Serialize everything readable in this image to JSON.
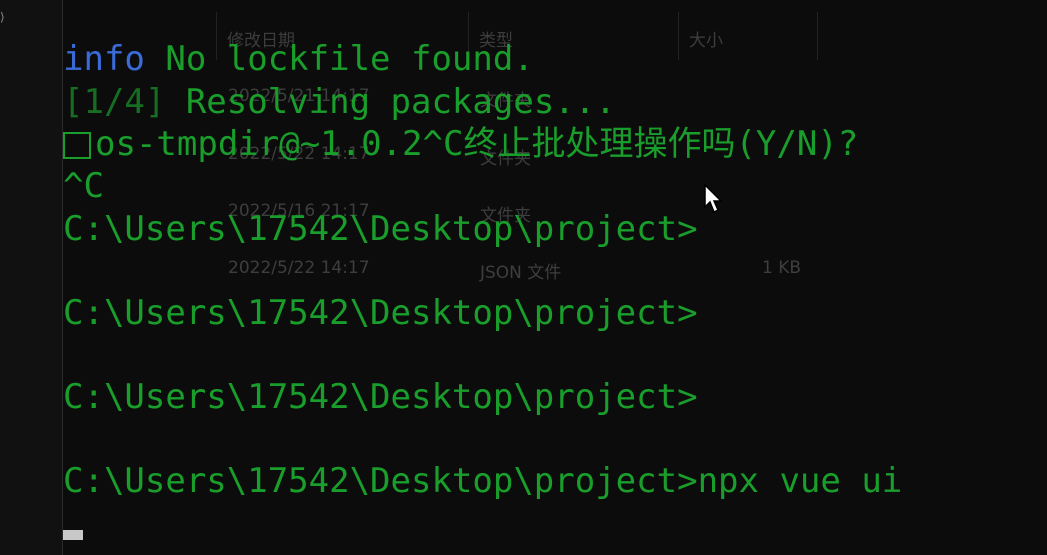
{
  "explorer_ghost": {
    "headers": [
      "修改日期",
      "类型",
      "大小"
    ],
    "rows": [
      {
        "date": "2022/5/21 14:17",
        "type": "文件夹",
        "size": ""
      },
      {
        "date": "2022/5/22 14:17",
        "type": "文件夹",
        "size": ""
      },
      {
        "date": "2022/5/16 21:17",
        "type": "文件夹",
        "size": ""
      },
      {
        "date": "2022/5/22 14:17",
        "type": "JSON 文件",
        "size": "1 KB"
      }
    ]
  },
  "terminal": {
    "info_tag": "info",
    "info_text": " No lockfile found.",
    "progress_step": "[1/4]",
    "progress_text": " Resolving packages...",
    "interrupt_text": "os-tmpdir@~1.0.2^C终止批处理操作吗(Y/N)?",
    "ctrl_c": "^C",
    "prompt1": "C:\\Users\\17542\\Desktop\\project>",
    "prompt2": "C:\\Users\\17542\\Desktop\\project>",
    "prompt3": "C:\\Users\\17542\\Desktop\\project>",
    "prompt4": "C:\\Users\\17542\\Desktop\\project>",
    "command": "npx vue ui"
  },
  "colors": {
    "background": "#0c0c0c",
    "prompt_green": "#1a9e2b",
    "info_blue": "#3a6bd8"
  },
  "icons": {
    "cursor": "mouse-pointer-icon",
    "caret": "chevron-icon"
  }
}
